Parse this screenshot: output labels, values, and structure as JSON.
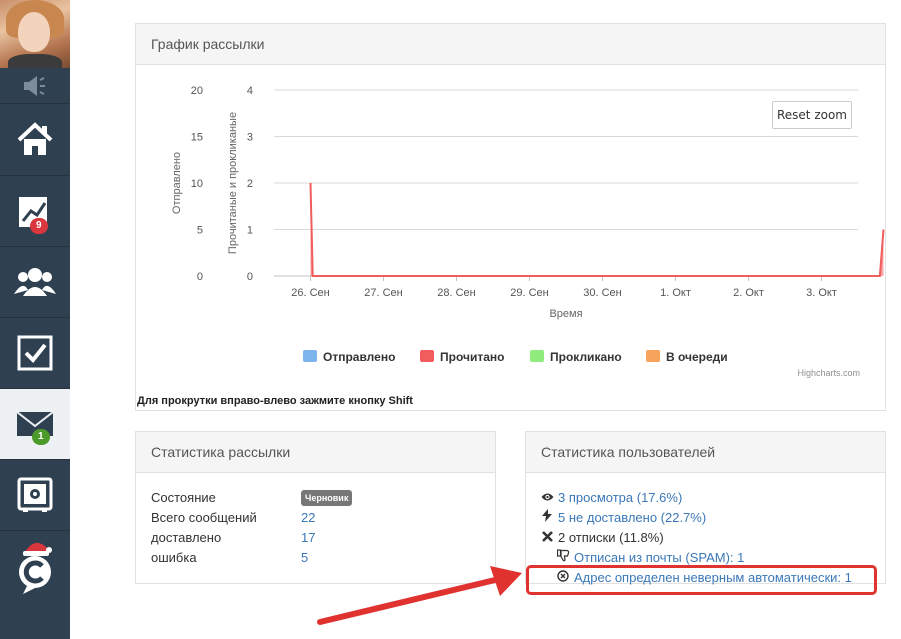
{
  "sidebar": {
    "badges": {
      "stats": "9",
      "mail": "1"
    },
    "icons": [
      "speaker-icon",
      "home-icon",
      "chart-icon",
      "users-icon",
      "checkbox-icon",
      "mail-icon",
      "safe-icon",
      "santa-hat-logo-icon"
    ]
  },
  "chart_panel": {
    "title": "График рассылки",
    "reset_zoom": "Reset zoom",
    "scroll_hint": "Для прокрутки вправо-влево зажмите кнопку Shift",
    "credit": "Highcharts.com"
  },
  "chart_data": {
    "type": "area",
    "xlabel": "Время",
    "ylabel_left": "Отправлено",
    "ylabel_right": "Прочитаные и прокликаные",
    "ylim_left": [
      0,
      20
    ],
    "ylim_right": [
      0,
      4
    ],
    "yticks_left": [
      "20",
      "15",
      "10",
      "5",
      "0"
    ],
    "yticks_right": [
      "4",
      "3",
      "2",
      "1",
      "0"
    ],
    "categories": [
      "26. Сен",
      "27. Сен",
      "28. Сен",
      "29. Сен",
      "30. Сен",
      "1. Окт",
      "2. Окт",
      "3. Окт"
    ],
    "grid": true,
    "legend_position": "bottom",
    "series": [
      {
        "name": "Отправлено",
        "color": "#7cb5ec",
        "values": [
          0,
          0,
          0,
          0,
          0,
          0,
          0,
          0
        ]
      },
      {
        "name": "Прочитано",
        "color": "#f15c5c",
        "points": [
          [
            0,
            2
          ],
          [
            0.03,
            0
          ],
          [
            7.8,
            0
          ],
          [
            7.85,
            1
          ]
        ]
      },
      {
        "name": "Прокликано",
        "color": "#90ed7d",
        "values": [
          0,
          0,
          0,
          0,
          0,
          0,
          0,
          0
        ]
      },
      {
        "name": "В очереди",
        "color": "#f7a35c",
        "values": [
          0,
          0,
          0,
          0,
          0,
          0,
          0,
          0
        ]
      }
    ]
  },
  "stats_panel": {
    "title": "Статистика рассылки",
    "rows": [
      {
        "label": "Состояние",
        "value": "Черновик",
        "badge": true
      },
      {
        "label": "Всего сообщений",
        "value": "22"
      },
      {
        "label": "доставлено",
        "value": "17"
      },
      {
        "label": "ошибка",
        "value": "5"
      }
    ]
  },
  "users_panel": {
    "title": "Статистика пользователей",
    "rows": [
      {
        "icon": "eye-icon",
        "text": "3 просмотра (17.6%)"
      },
      {
        "icon": "bolt-icon",
        "text": "5 не доставлено (22.7%)"
      },
      {
        "icon": "x-icon",
        "text": "2 отписки (11.8%)"
      },
      {
        "icon": "thumbs-down-icon",
        "text": "Отписан из почты (SPAM): 1"
      },
      {
        "icon": "times-circle-icon",
        "text": "Адрес определен неверным автоматически: 1"
      }
    ]
  }
}
